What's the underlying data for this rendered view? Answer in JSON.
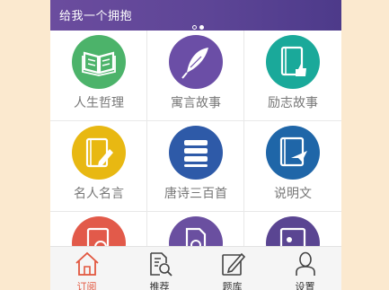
{
  "banner": {
    "title": "给我一个拥抱",
    "dots": [
      "off",
      "on"
    ]
  },
  "categories": [
    {
      "label": "人生哲理",
      "icon": "open-book-icon",
      "color": "#4cb36a"
    },
    {
      "label": "寓言故事",
      "icon": "feather-icon",
      "color": "#6b4ea6"
    },
    {
      "label": "励志故事",
      "icon": "book-thumbs-up-icon",
      "color": "#1aa99a"
    },
    {
      "label": "名人名言",
      "icon": "book-pen-icon",
      "color": "#e8b812"
    },
    {
      "label": "唐诗三百首",
      "icon": "book-stack-icon",
      "color": "#2e5aa8"
    },
    {
      "label": "说明文",
      "icon": "book-plane-icon",
      "color": "#1f66a8"
    },
    {
      "label": "",
      "icon": "book-clock-icon",
      "color": "#e25a4a"
    },
    {
      "label": "",
      "icon": "document-search-icon",
      "color": "#6a4fa0"
    },
    {
      "label": "",
      "icon": "book-image-icon",
      "color": "#5a4592"
    }
  ],
  "tabbar": {
    "active_color": "#e2563e",
    "tabs": [
      {
        "label": "订阅",
        "icon": "home-icon",
        "active": true
      },
      {
        "label": "推荐",
        "icon": "document-search-icon",
        "active": false
      },
      {
        "label": "题库",
        "icon": "edit-icon",
        "active": false
      },
      {
        "label": "设置",
        "icon": "user-icon",
        "active": false
      }
    ]
  }
}
